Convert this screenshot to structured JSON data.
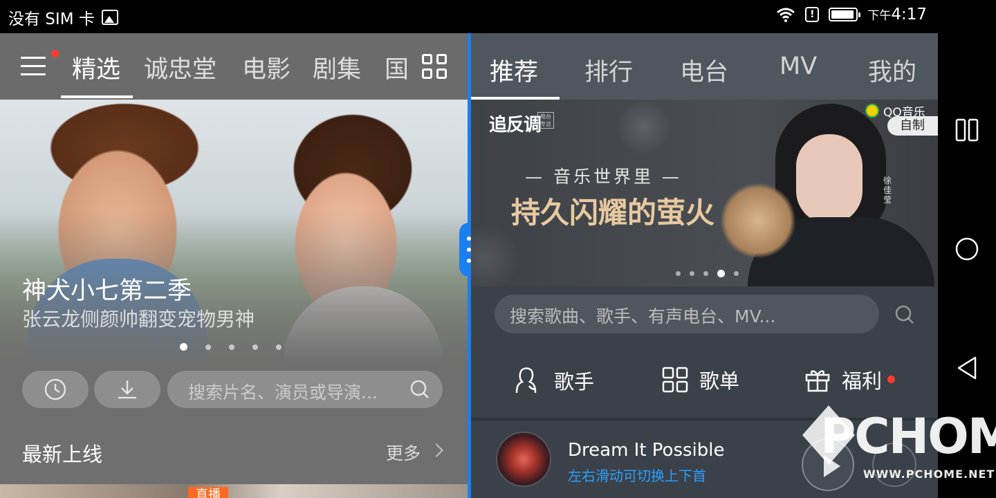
{
  "status_bar": {
    "carrier": "没有 SIM 卡",
    "time_prefix": "下午",
    "time": "4:17"
  },
  "video_app": {
    "tabs": [
      "精选",
      "诚忠堂",
      "电影",
      "剧集",
      "国"
    ],
    "active_tab": 0,
    "banner": {
      "title": "神犬小七第二季",
      "subtitle": "张云龙侧颜帅翻变宠物男神",
      "page_index": 0,
      "page_count": 5
    },
    "search_placeholder": "搜索片名、演员或导演...",
    "section_title": "最新上线",
    "more_label": "更多",
    "live_badge": "直播"
  },
  "music_app": {
    "tabs": [
      "推荐",
      "排行",
      "电台",
      "MV",
      "我的"
    ],
    "active_tab": 0,
    "banner": {
      "brand": "追反调",
      "brand_tag": "电台专访",
      "line1": "— 音乐世界里 —",
      "line2": "持久闪耀的萤火",
      "source": "QQ音乐",
      "badge": "自制",
      "side_text": "徐佳莹",
      "page_index": 3,
      "page_count": 5
    },
    "search_placeholder": "搜索歌曲、歌手、有声电台、MV...",
    "quick_links": [
      {
        "label": "歌手",
        "icon": "singer-icon"
      },
      {
        "label": "歌单",
        "icon": "playlist-grid-icon"
      },
      {
        "label": "福利",
        "icon": "gift-icon"
      }
    ],
    "player": {
      "song": "Dream It Possible",
      "hint": "左右滑动可切换上下首"
    }
  },
  "watermark": {
    "brand": "PCHOME",
    "url": "WWW.PCHOME.NET"
  },
  "colors": {
    "accent_blue": "#1a7ff0",
    "notification_red": "#ff3b30",
    "live_orange": "#ff6a21",
    "hint_blue": "#2aa0ff"
  }
}
